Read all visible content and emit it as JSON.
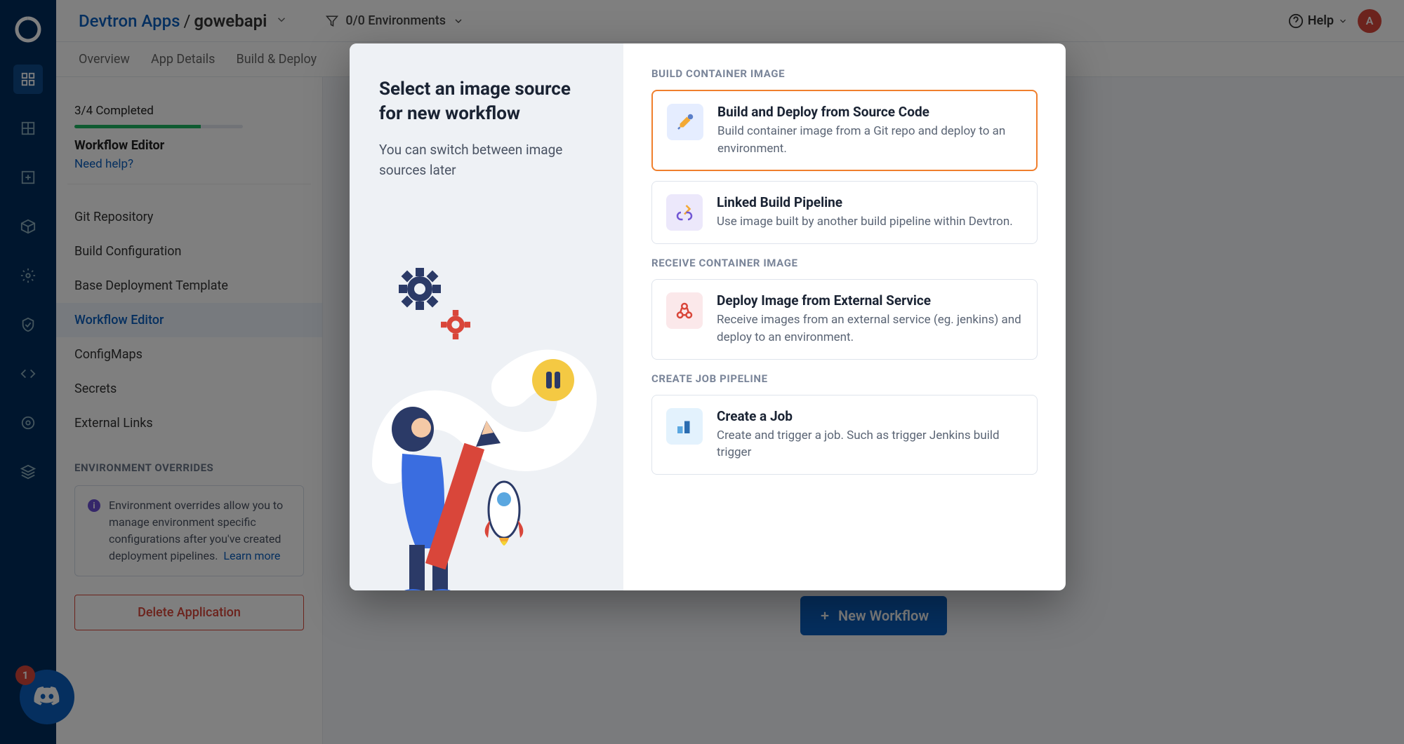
{
  "breadcrumb": {
    "root": "Devtron Apps",
    "app": "gowebapi"
  },
  "header": {
    "env_count": "0/0 Environments",
    "help": "Help",
    "avatar_initial": "A"
  },
  "tabs": {
    "overview": "Overview",
    "details": "App Details",
    "build": "Build & Deploy"
  },
  "sidebar": {
    "progress": "3/4 Completed",
    "title": "Workflow Editor",
    "help": "Need help?",
    "items": [
      "Git Repository",
      "Build Configuration",
      "Base Deployment Template",
      "Workflow Editor",
      "ConfigMaps",
      "Secrets",
      "External Links"
    ],
    "env_over_title": "ENVIRONMENT OVERRIDES",
    "env_over_text": "Environment overrides allow you to manage environment specific configurations after you've created deployment pipelines.",
    "learn": "Learn more",
    "delete": "Delete Application"
  },
  "main": {
    "new_workflow": "New Workflow"
  },
  "discord": {
    "badge": "1"
  },
  "modal": {
    "title": "Select an image source for new workflow",
    "subtitle": "You can switch between image sources later",
    "sections": {
      "build": "BUILD CONTAINER IMAGE",
      "receive": "RECEIVE CONTAINER IMAGE",
      "job": "CREATE JOB PIPELINE"
    },
    "options": {
      "build_deploy": {
        "title": "Build and Deploy from Source Code",
        "desc": "Build container image from a Git repo and deploy to an environment."
      },
      "linked": {
        "title": "Linked Build Pipeline",
        "desc": "Use image built by another build pipeline within Devtron."
      },
      "external": {
        "title": "Deploy Image from External Service",
        "desc": "Receive images from an external service (eg. jenkins) and deploy to an environment."
      },
      "job": {
        "title": "Create a Job",
        "desc": "Create and trigger a job. Such as trigger Jenkins build trigger"
      }
    }
  }
}
